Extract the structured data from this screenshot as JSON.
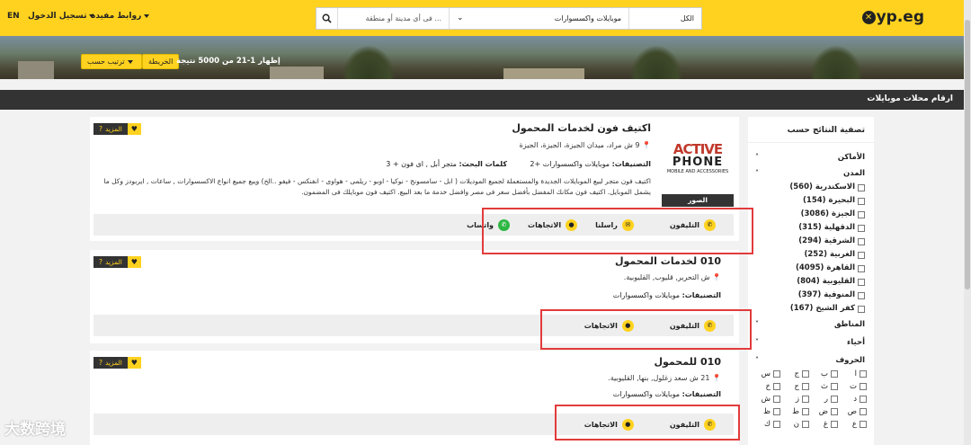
{
  "header": {
    "lang": "EN",
    "login": "تسجيل الدخول",
    "links": "روابط مفيدة",
    "logo": "yp.eg",
    "search_where_placeholder": "... فى أى مدينة أو منطقة",
    "search_what": "موبايلات واكسسوارات",
    "search_scope": "الكل"
  },
  "toolbar": {
    "sort": "ترتيب حسب",
    "map": "الخريطة",
    "count": "إظهار 1-21 من 5000 نتيجة"
  },
  "strip": "ارقام محلات موبايلات",
  "sidebar": {
    "title": "تصفية النتائج حسب",
    "places": "الأماكن",
    "cities_label": "المدن",
    "cities": [
      "الاسكندرية (560)",
      "البحيرة (154)",
      "الجيزة (3086)",
      "الدقهلية (315)",
      "الشرقية (294)",
      "الغربية (252)",
      "القاهرة (4095)",
      "القليوبية (804)",
      "المنوفية (397)",
      "كفر الشيخ (167)"
    ],
    "areas": "المناطق",
    "districts": "أحياء",
    "letters_label": "الحروف",
    "letters": [
      "ا",
      "ب",
      "ج",
      "س",
      "ت",
      "ث",
      "ح",
      "خ",
      "د",
      "ر",
      "ز",
      "ش",
      "ص",
      "ض",
      "ط",
      "ظ",
      "ع",
      "غ",
      "ن",
      "ك"
    ]
  },
  "common": {
    "more": "المزيد",
    "photos": "الصور",
    "phone": "التليفون",
    "message": "راسلنا",
    "directions": "الاتجاهات",
    "whatsapp": "واتساب",
    "cats_label": "التصنيفات:",
    "keywords_label": "كلمات البحث:"
  },
  "listings": [
    {
      "title": "اكتيف فون لخدمات المحمول",
      "address": "9 ش مراد، ميدان الجيزة، الجيزة، الجيزة",
      "categories": "موبايلات واكسسوارات +2",
      "keywords": "متجر أبل , اى فون + 3",
      "description": "اكتيف فون متجر لبيع الموبايلات الجديدة والمستعملة لجميع الموديلات ( ابل - سامسونج - نوكيا - اوبو - ريلمى - هواوى - انفنكس - فيفو ..الخ) ويبع جميع انواع الاكسسوارات , ساعات , ايربودز وكل ما يشمل الموبايل. اكتيف فون مكانك المفضل بأفضل سعر فى مصر وافضل خدمة ما بعد البيع. اكتيف فون موبايلك فى المضمون.",
      "brand": [
        "ACTIVE",
        "PHONE",
        "MOBILE AND ACCESSORIES"
      ]
    },
    {
      "title": "010 لخدمات المحمول",
      "address": "ش التحرير, قليوب, القليوبية.",
      "categories": "موبايلات واكسسوارات"
    },
    {
      "title": "010 للمحمول",
      "address": "21 ش سعد زغلول, بنها, القليوبية.",
      "categories": "موبايلات واكسسوارات"
    }
  ],
  "watermark": "大数跨境"
}
